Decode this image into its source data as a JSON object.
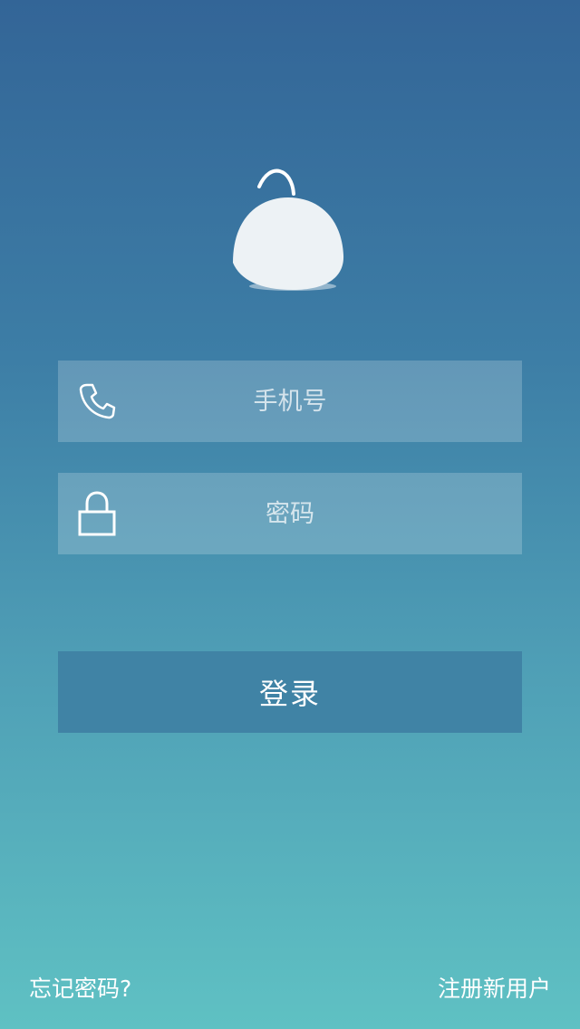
{
  "app": {
    "logo_icon": "round-mascot-logo-icon"
  },
  "form": {
    "phone": {
      "icon": "phone-icon",
      "placeholder": "手机号",
      "value": ""
    },
    "password": {
      "icon": "lock-icon",
      "placeholder": "密码",
      "value": ""
    },
    "login_label": "登录"
  },
  "footer": {
    "forgot_password": "忘记密码?",
    "register": "注册新用户"
  },
  "colors": {
    "background_top": "#336597",
    "background_bottom": "#5fc1c3",
    "login_button": "#4083a5",
    "field_overlay": "rgba(255,255,255,0.2)",
    "text": "#ffffff"
  }
}
